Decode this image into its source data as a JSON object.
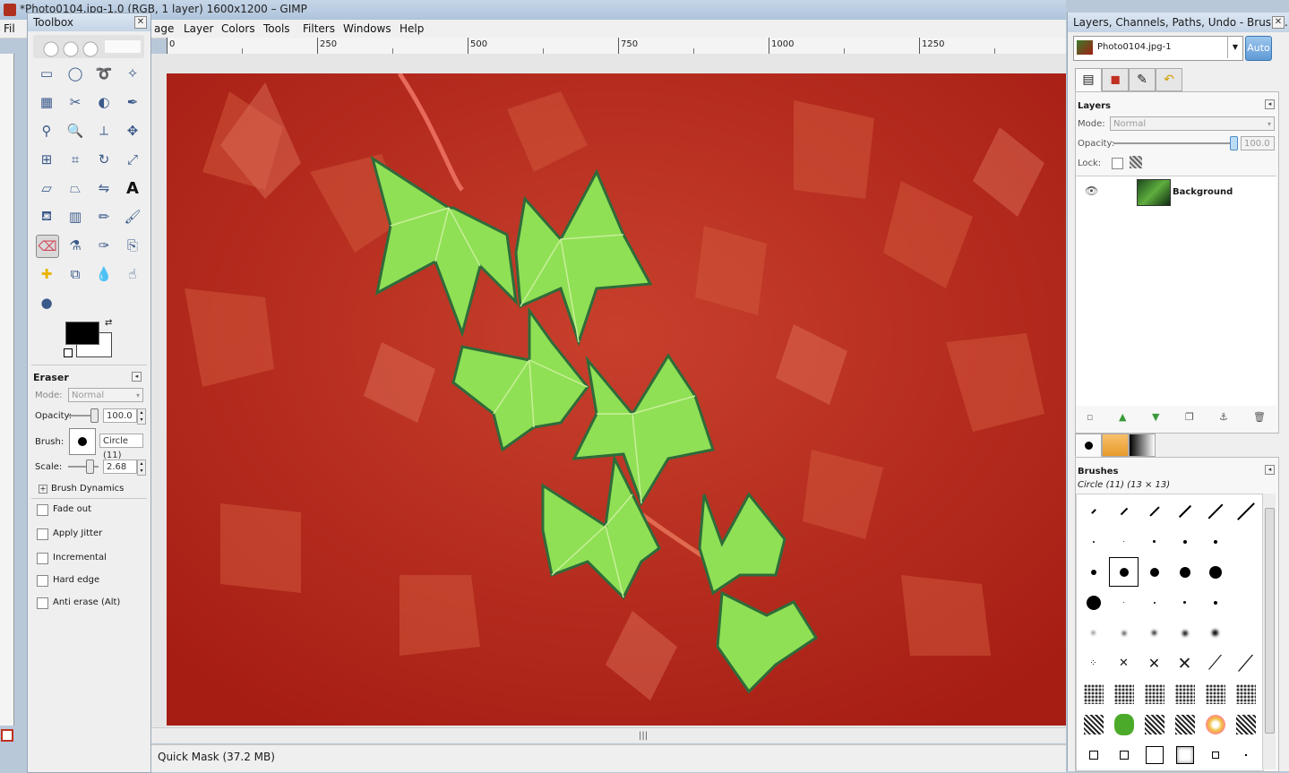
{
  "window": {
    "title": "*Photo0104.jpg-1.0 (RGB, 1 layer) 1600x1200 – GIMP"
  },
  "menubar": {
    "items": [
      "File",
      "Image",
      "Layer",
      "Colors",
      "Tools",
      "Filters",
      "Windows",
      "Help"
    ],
    "visible_labels": [
      "Fil",
      "age",
      "Layer",
      "Colors",
      "Tools",
      "Filters",
      "Windows",
      "Help"
    ]
  },
  "ruler": {
    "labels": [
      "0",
      "250",
      "500",
      "750",
      "1000",
      "1250"
    ]
  },
  "statusbar": {
    "text": "Quick Mask (37.2 MB)"
  },
  "toolbox": {
    "title": "Toolbox",
    "tools": [
      "rect-select-icon",
      "ellipse-select-icon",
      "lasso-icon",
      "fuzzy-select-icon",
      "color-select-icon",
      "scissors-icon",
      "foreground-select-icon",
      "paths-icon",
      "color-picker-icon",
      "zoom-icon",
      "measure-icon",
      "move-icon",
      "align-icon",
      "crop-icon",
      "rotate-icon",
      "scale-icon",
      "shear-icon",
      "perspective-icon",
      "flip-icon",
      "text-icon",
      "bucket-fill-icon",
      "blend-icon",
      "pencil-icon",
      "paintbrush-icon",
      "eraser-icon",
      "airbrush-icon",
      "ink-icon",
      "clone-icon",
      "heal-icon",
      "perspective-clone-icon",
      "blur-icon",
      "smudge-icon",
      "dodge-burn-icon"
    ],
    "active_tool": "eraser-icon",
    "fg_color": "#000000",
    "bg_color": "#ffffff",
    "options": {
      "title": "Eraser",
      "mode_label": "Mode:",
      "mode_value": "Normal",
      "opacity_label": "Opacity:",
      "opacity_value": "100.0",
      "opacity": 100,
      "brush_label": "Brush:",
      "brush_value": "Circle (11)",
      "scale_label": "Scale:",
      "scale_value": "2.68",
      "brush_dynamics": "Brush Dynamics",
      "checkboxes": [
        "Fade out",
        "Apply Jitter",
        "Incremental",
        "Hard edge",
        "Anti erase  (Alt)"
      ]
    }
  },
  "dock": {
    "title": "Layers, Channels, Paths, Undo - Brushe...",
    "image_name": "Photo0104.jpg-1",
    "auto_label": "Auto",
    "layers": {
      "title": "Layers",
      "mode_label": "Mode:",
      "mode_value": "Normal",
      "opacity_label": "Opacity:",
      "opacity_value": "100.0",
      "opacity": 100,
      "lock_label": "Lock:",
      "layer_name": "Background"
    },
    "brushes": {
      "title": "Brushes",
      "selected": "Circle (11) (13 × 13)"
    }
  },
  "colors": {
    "quickmask": "#c0291c",
    "leaf_green": "#8fe055"
  }
}
